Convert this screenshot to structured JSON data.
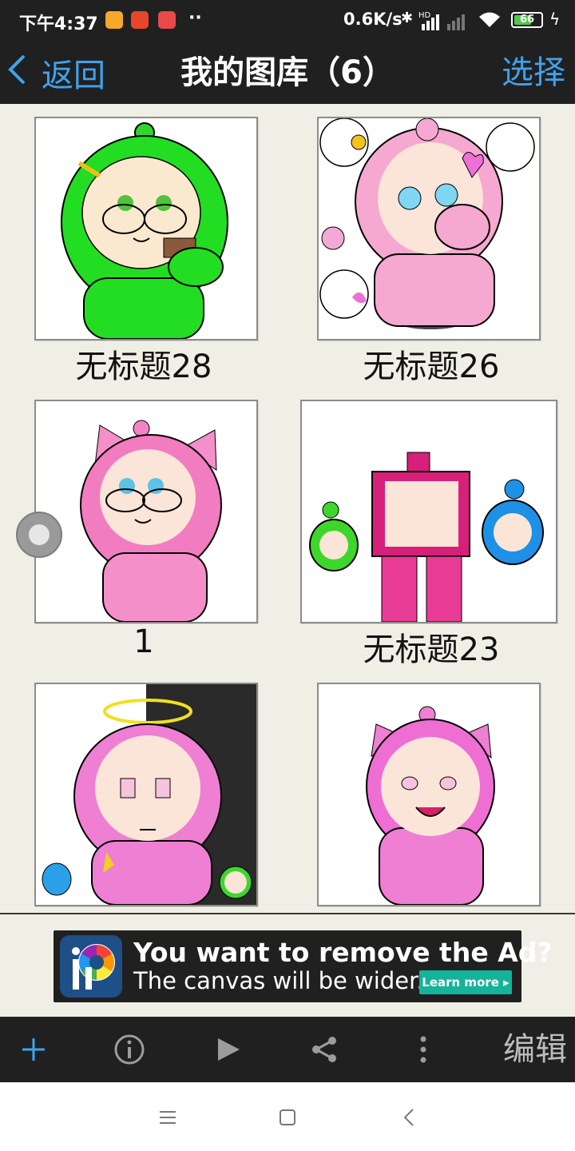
{
  "status_bar": {
    "time": "下午4:37",
    "dots": "··",
    "net_speed": "0.6K/s",
    "hd_label": "HD",
    "battery_level": "66",
    "battery_fraction": 0.66,
    "icons": [
      "app-notification-icon",
      "app-notification-icon",
      "music-app-icon",
      "bluetooth-icon",
      "signal-icon",
      "wifi-icon",
      "battery-icon",
      "charging-icon"
    ]
  },
  "nav": {
    "back_label": "返回",
    "title": "我的图库（6）",
    "select_label": "选择"
  },
  "gallery": {
    "items": [
      {
        "label": "无标题28"
      },
      {
        "label": "无标题26"
      },
      {
        "label": "1"
      },
      {
        "label": "无标题23"
      },
      {
        "label": ""
      },
      {
        "label": ""
      }
    ]
  },
  "ad": {
    "headline": "You want to remove the Ad?",
    "subline": "The canvas will be wider.",
    "cta": "Learn more ▸"
  },
  "toolbar": {
    "edit_label": "编辑",
    "icons": [
      "plus-icon",
      "info-icon",
      "play-icon",
      "share-icon",
      "more-icon"
    ]
  },
  "colors": {
    "accent": "#3ea3ee",
    "bar_background": "#202020",
    "page_background": "#efefe6",
    "ad_cta": "#14b39a"
  }
}
